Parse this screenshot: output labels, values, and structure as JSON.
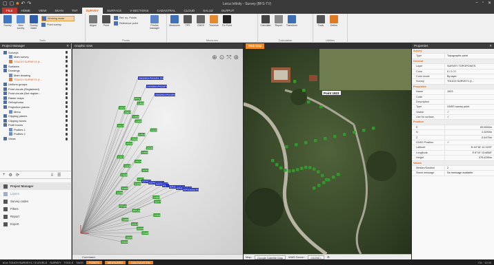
{
  "app": {
    "title": "Leica Infinity - Survey (BFS-TV)",
    "window_controls": [
      "–",
      "▫",
      "✕"
    ]
  },
  "ribbon": {
    "tabs": [
      "FILE",
      "HOME",
      "VIEW",
      "SKAN",
      "TNT",
      "SURVEY",
      "SURFACE",
      "V-SECTIONS",
      "CADASTRAL",
      "CLOUD",
      "SALUZ",
      "OUTPUT"
    ],
    "active_tab": "SURVEY",
    "groups": [
      {
        "name": "Tools",
        "buttons": [
          "Survey",
          "New survey",
          "Survey folder"
        ],
        "stack": [
          "Working mode",
          "Point survey"
        ]
      },
      {
        "name": "Points",
        "buttons": [
          "Aligne",
          "Point"
        ],
        "stack": [
          "Ref. no. Points",
          "Reference point"
        ],
        "big": [
          "Photos manager"
        ]
      },
      {
        "name": "Measures",
        "buttons": [
          "Measures",
          "TPS",
          "GNSS",
          "Traverse",
          "Fix Point"
        ]
      },
      {
        "name": "Calculation",
        "buttons": [
          "Calculate",
          "Report",
          "Transform"
        ]
      },
      {
        "name": "Utilities",
        "buttons": [
          "Tools",
          "Deline"
        ]
      }
    ]
  },
  "project_manager": {
    "title": "Project Manager",
    "tree": [
      {
        "label": "Surveys",
        "indent": 0,
        "orange": false
      },
      {
        "label": "Main survey",
        "indent": 1,
        "orange": false
      },
      {
        "label": "TOUCH SURVEY1 (t...",
        "indent": 1,
        "orange": true
      },
      {
        "label": "Surfaces",
        "indent": 0,
        "orange": false
      },
      {
        "label": "Drawings",
        "indent": 0,
        "orange": false
      },
      {
        "label": "Main drawing",
        "indent": 1,
        "orange": false
      },
      {
        "label": "TOUCH SURVEY1 (t...",
        "indent": 1,
        "orange": true
      },
      {
        "label": "Uniform groups",
        "indent": 0,
        "orange": false
      },
      {
        "label": "Point clouds (Registered)",
        "indent": 0,
        "orange": false
      },
      {
        "label": "Point clouds (Not registe...",
        "indent": 0,
        "orange": false
      },
      {
        "label": "Raster maps",
        "indent": 0,
        "orange": false
      },
      {
        "label": "Orthophotos",
        "indent": 0,
        "orange": false
      },
      {
        "label": "Projection planes",
        "indent": 0,
        "orange": false
      },
      {
        "label": "Menu",
        "indent": 1,
        "orange": false
      },
      {
        "label": "Clipping planes",
        "indent": 0,
        "orange": false
      },
      {
        "label": "Clipping boxes",
        "indent": 0,
        "orange": false
      },
      {
        "label": "Profil boxes",
        "indent": 0,
        "orange": false
      },
      {
        "label": "Profiles 1",
        "indent": 1,
        "orange": false
      },
      {
        "label": "Profiles 2",
        "indent": 1,
        "orange": false
      },
      {
        "label": "Views",
        "indent": 0,
        "orange": false
      }
    ],
    "nav": [
      "Project Manager",
      "Layers",
      "Survey codes",
      "Filters",
      "Report",
      "Export"
    ]
  },
  "graphic_view": {
    "title": "Graphic view",
    "status": "Command:",
    "labels": [
      "2902001P001R1 R1",
      "2903001P001P1",
      "2902001P002R1",
      "PP0",
      "1908",
      "1903",
      "2907",
      "1908",
      "1909",
      "1913",
      "1915",
      "1916",
      "2908",
      "2932",
      "2936",
      "1990",
      "1921",
      "1924",
      "1928",
      "1931",
      "1934",
      "1937",
      "1940",
      "1945",
      "1948",
      "1952",
      "1977",
      "PPU02",
      "PPU04",
      "1904",
      "1999",
      "1910",
      "2944",
      "2945",
      "2930",
      "2931",
      "STP001",
      "STP002P001",
      "STP001P2",
      "P1",
      "EPS1002 R1",
      "EPS1003 R1",
      "EPS1004 R1"
    ]
  },
  "map_view": {
    "title": "Web Map",
    "tooltip": "Point 1923",
    "status": {
      "map_label": "Map:",
      "map_value": "Google Satellite Map",
      "wms_label": "WMS Server:",
      "wms_value": "<NONE>"
    }
  },
  "properties": {
    "title": "Properties",
    "rows": [
      {
        "section": "Survey"
      },
      {
        "k": "Type",
        "v": "Topographic point"
      },
      {
        "section": "General"
      },
      {
        "k": "Layer",
        "v": "SURVEY TOPOPOINTS"
      },
      {
        "k": "Color",
        "v": "0 / 0 / 0"
      },
      {
        "k": "Color mode",
        "v": "By layer"
      },
      {
        "k": "Survey",
        "v": "TOUCH SURVEY1 (t..."
      },
      {
        "section": "Properties"
      },
      {
        "k": "Name",
        "v": "1923"
      },
      {
        "k": "Code",
        "v": ""
      },
      {
        "k": "Description",
        "v": ""
      },
      {
        "k": "Type",
        "v": "GNSS survey point"
      },
      {
        "k": "Visible",
        "v": "✓"
      },
      {
        "k": "Use for surface",
        "v": "✓"
      },
      {
        "section": "Position"
      },
      {
        "k": "E",
        "v": "83.5000m",
        "num": true
      },
      {
        "k": "N",
        "v": "2.3290m",
        "num": true
      },
      {
        "k": "Z",
        "v": "-3.4470m",
        "num": true
      },
      {
        "k": "GNSS Position",
        "v": "✓"
      },
      {
        "k": "Latitude",
        "v": "N 44°18' 12.1199\"",
        "num": true
      },
      {
        "k": "Longitude",
        "v": "E 8°10' 13.6838\"",
        "num": true
      },
      {
        "k": "Height",
        "v": "375.4250m",
        "num": true
      },
      {
        "section": "Values"
      },
      {
        "k": "Median/Solution",
        "v": "2"
      },
      {
        "k": "Stand message",
        "v": "No message available"
      }
    ]
  },
  "taskbar": {
    "items": [
      "#1 ▸ TOUCH SURVEY1 / 3 LEVELS",
      "SURVEY",
      "TOOLS",
      "TAGS",
      "POINTS",
      "MEASURES",
      "CALCULATION"
    ],
    "right": "ITA  ·  12:00"
  },
  "colors": {
    "accent": "#f08a24",
    "point_green": "#2f9a2a",
    "point_blue": "#2233cc",
    "file_red": "#c4342d"
  }
}
